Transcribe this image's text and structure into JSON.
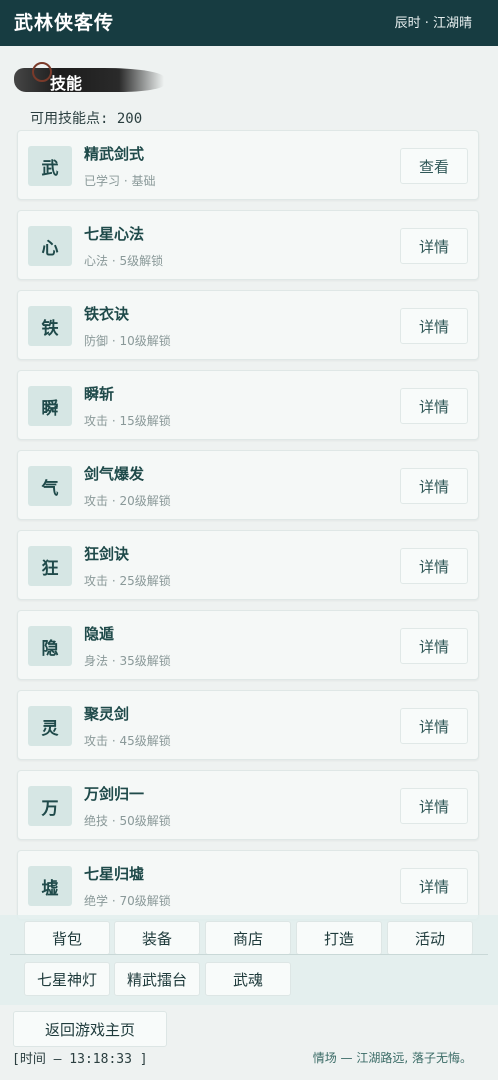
{
  "header": {
    "title": "武林侠客传",
    "status": "辰时 · 江湖晴"
  },
  "section": {
    "title": "技能"
  },
  "skill_points": "可用技能点: 200",
  "skills": [
    {
      "icon": "武",
      "name": "精武剑式",
      "meta": "已学习 · 基础",
      "action": "查看"
    },
    {
      "icon": "心",
      "name": "七星心法",
      "meta": "心法 · 5级解锁",
      "action": "详情"
    },
    {
      "icon": "铁",
      "name": "铁衣诀",
      "meta": "防御 · 10级解锁",
      "action": "详情"
    },
    {
      "icon": "瞬",
      "name": "瞬斩",
      "meta": "攻击 · 15级解锁",
      "action": "详情"
    },
    {
      "icon": "气",
      "name": "剑气爆发",
      "meta": "攻击 · 20级解锁",
      "action": "详情"
    },
    {
      "icon": "狂",
      "name": "狂剑诀",
      "meta": "攻击 · 25级解锁",
      "action": "详情"
    },
    {
      "icon": "隐",
      "name": "隐遁",
      "meta": "身法 · 35级解锁",
      "action": "详情"
    },
    {
      "icon": "灵",
      "name": "聚灵剑",
      "meta": "攻击 · 45级解锁",
      "action": "详情"
    },
    {
      "icon": "万",
      "name": "万剑归一",
      "meta": "绝技 · 50级解锁",
      "action": "详情"
    },
    {
      "icon": "墟",
      "name": "七星归墟",
      "meta": "绝学 · 70级解锁",
      "action": "详情"
    }
  ],
  "nav": {
    "row1": [
      "背包",
      "装备",
      "商店",
      "打造",
      "活动"
    ],
    "row2": [
      "七星神灯",
      "精武擂台",
      "武魂"
    ]
  },
  "footer": {
    "home": "返回游戏主页",
    "clock": "[时间 — 13:18:33 ]",
    "quote": "情场 — 江湖路远, 落子无悔。"
  }
}
